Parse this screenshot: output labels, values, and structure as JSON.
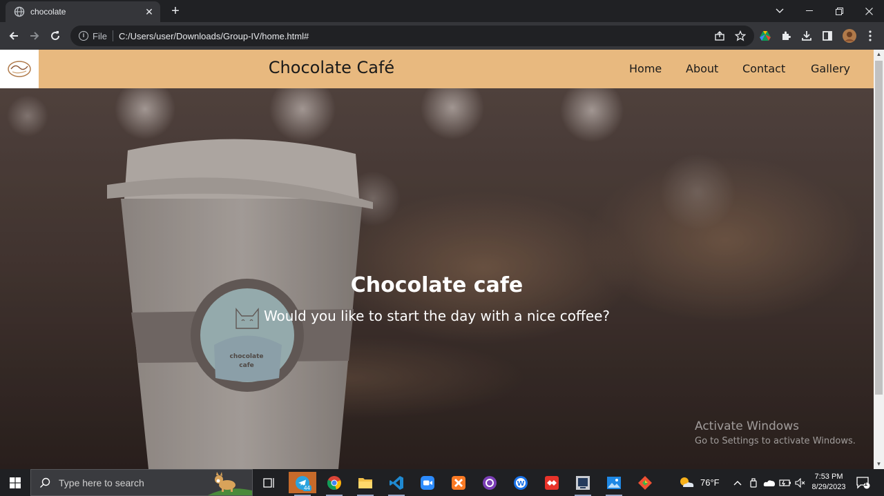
{
  "browser": {
    "tab_title": "chocolate",
    "url_scheme": "File",
    "url": "C:/Users/user/Downloads/Group-IV/home.html#"
  },
  "site": {
    "title": "Chocolate Café",
    "nav": [
      "Home",
      "About",
      "Contact",
      "Gallery"
    ],
    "hero_title": "Chocolate cafe",
    "hero_subtitle": "Would you like to start the day with a nice coffee?",
    "cup_text": [
      "chocolate",
      "cafe"
    ]
  },
  "watermark": {
    "line1": "Activate Windows",
    "line2": "Go to Settings to activate Windows."
  },
  "taskbar": {
    "search_placeholder": "Type here to search",
    "telegram_badge": "44",
    "weather": "76°F",
    "time": "7:53 PM",
    "date": "8/29/2023",
    "notification_count": "1"
  },
  "colors": {
    "nav_bg": "#e8b97f",
    "chrome_dark": "#202124",
    "chrome_toolbar": "#35363a"
  }
}
